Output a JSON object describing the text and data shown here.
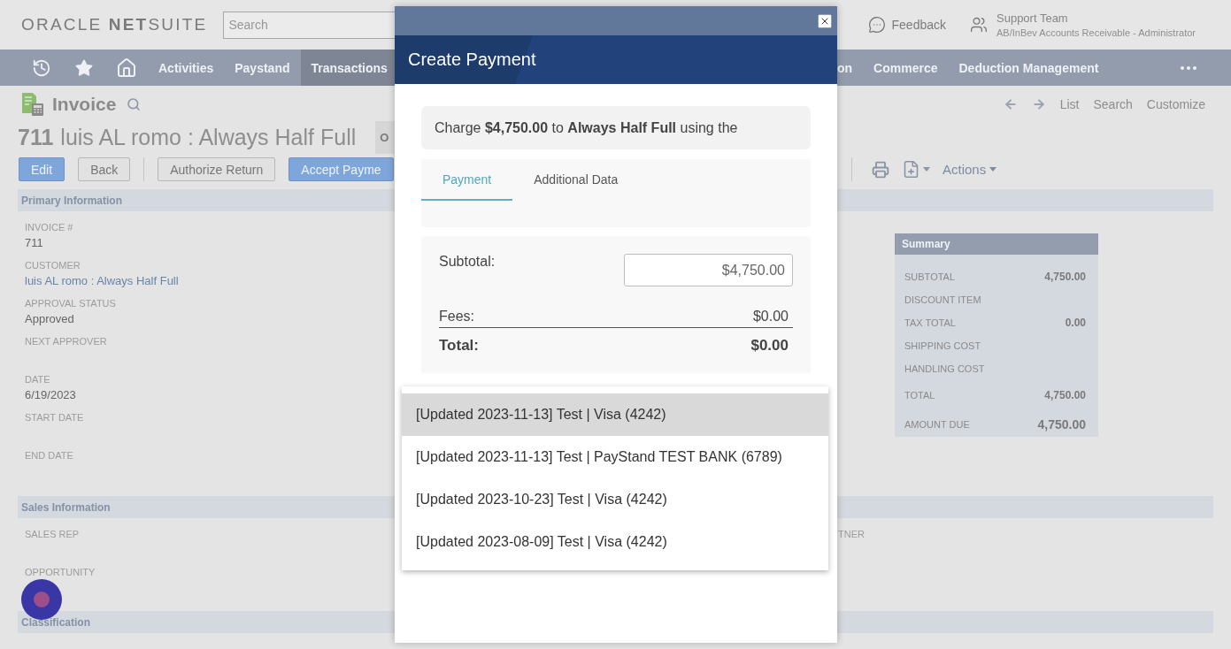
{
  "header": {
    "logo": "ORACLE **NET**SUITE",
    "search": {
      "placeholder": "Search"
    },
    "feedback": "Feedback",
    "user": {
      "name": "Support Team",
      "role": "AB/InBev Accounts Receivable - Administrator"
    }
  },
  "nav": {
    "items": [
      {
        "label": "Activities",
        "selected": false
      },
      {
        "label": "Paystand",
        "selected": false
      },
      {
        "label": "Transactions",
        "selected": true
      }
    ],
    "items_right": [
      {
        "label": "on",
        "selected": false
      },
      {
        "label": "Commerce",
        "selected": false
      },
      {
        "label": "Deduction Management",
        "selected": false
      }
    ]
  },
  "record": {
    "type": "Invoice",
    "number": "711",
    "name": "luis AL romo : Always Half Full",
    "status": "O",
    "links": [
      "List",
      "Search",
      "Customize"
    ]
  },
  "toolbar": {
    "buttons": [
      {
        "label": "Edit",
        "kind": "primary",
        "divider_before": false
      },
      {
        "label": "Back",
        "kind": "secondary",
        "divider_before": false
      },
      {
        "label": "Authorize Return",
        "kind": "secondary",
        "divider_before": true
      },
      {
        "label": "Accept Payme",
        "kind": "primary",
        "divider_before": false
      }
    ],
    "actions": "Actions"
  },
  "primary_information": {
    "title": "Primary Information",
    "fields": [
      {
        "label": "INVOICE #",
        "value": "711",
        "kind": "text"
      },
      {
        "label": "CUSTOMER",
        "value": "luis AL romo : Always Half Full",
        "kind": "link"
      },
      {
        "label": "APPROVAL STATUS",
        "value": "Approved",
        "kind": "text"
      },
      {
        "label": "NEXT APPROVER"
      },
      {
        "label": "DATE",
        "value": "6/19/2023",
        "kind": "text"
      },
      {
        "label": "START DATE"
      },
      {
        "label": "END DATE"
      }
    ],
    "summary": {
      "title": "Summary",
      "rows": [
        {
          "label": "SUBTOTAL",
          "value": "4,750.00",
          "kind": "line"
        },
        {
          "label": "DISCOUNT ITEM",
          "kind": "line"
        },
        {
          "label": "TAX TOTAL",
          "value": "0.00",
          "kind": "line"
        },
        {
          "label": "SHIPPING COST",
          "kind": "line"
        },
        {
          "label": "HANDLING COST",
          "kind": "line"
        },
        {
          "label": "TOTAL",
          "value": "4,750.00",
          "kind": "total"
        },
        {
          "label": "AMOUNT DUE",
          "value": "4,750.00",
          "kind": "due"
        }
      ]
    }
  },
  "sales_information": {
    "title": "Sales Information",
    "fields": [
      {
        "label": "SALES REP"
      },
      {
        "label": "OPPORTUNITY"
      }
    ],
    "fields_right": [
      {
        "label": "TNER"
      }
    ]
  },
  "classification": {
    "title": "Classification"
  },
  "dialog": {
    "title": "Create Payment",
    "charge": "Charge **$4,750.00** to **Always Half Full** using the",
    "tabs": [
      {
        "label": "Payment",
        "selected": true
      },
      {
        "label": "Additional Data",
        "selected": false
      }
    ],
    "subtotal": {
      "label": "Subtotal:",
      "value": "$4,750.00"
    },
    "fees": {
      "label": "Fees:",
      "value": "$0.00"
    },
    "total": {
      "label": "Total:",
      "value": "$0.00"
    },
    "options": [
      {
        "label": "[Updated 2023-11-13] Test | Visa (4242)",
        "selected": true
      },
      {
        "label": "[Updated 2023-11-13] Test | PayStand TEST BANK (6789)",
        "selected": false
      },
      {
        "label": "[Updated 2023-10-23] Test | Visa (4242)",
        "selected": false
      },
      {
        "label": "[Updated 2023-08-09] Test | Visa (4242)",
        "selected": false
      }
    ]
  }
}
